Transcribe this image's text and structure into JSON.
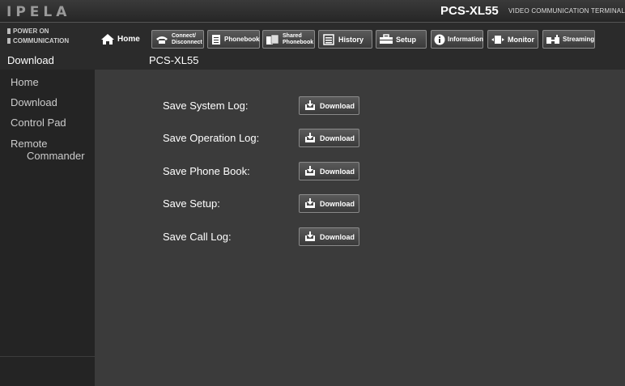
{
  "header": {
    "logo": "IPELA",
    "model": "PCS-XL55",
    "subtitle": "VIDEO COMMUNICATION TERMINAL"
  },
  "status": {
    "power": "POWER ON",
    "communication": "COMMUNICATION"
  },
  "toolbar": {
    "home": "Home",
    "connect_l1": "Connect/",
    "connect_l2": "Disconnect",
    "phonebook": "Phonebook",
    "shared_l1": "Shared",
    "shared_l2": "Phonebook",
    "history": "History",
    "setup": "Setup",
    "information": "Information",
    "monitor": "Monitor",
    "streaming": "Streaming"
  },
  "page": {
    "title": "Download",
    "device": "PCS-XL55"
  },
  "sidebar": {
    "items": [
      {
        "label": "Home"
      },
      {
        "label": "Download"
      },
      {
        "label": "Control Pad"
      },
      {
        "label_l1": "Remote",
        "label_l2": "Commander"
      }
    ]
  },
  "downloads": [
    {
      "label": "Save System Log:",
      "button": "Download"
    },
    {
      "label": "Save Operation Log:",
      "button": "Download"
    },
    {
      "label": "Save Phone Book:",
      "button": "Download"
    },
    {
      "label": "Save Setup:",
      "button": "Download"
    },
    {
      "label": "Save Call Log:",
      "button": "Download"
    }
  ]
}
